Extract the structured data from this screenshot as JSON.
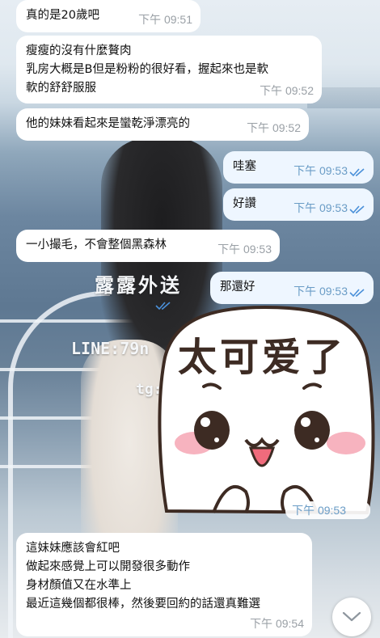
{
  "chat": {
    "messages": [
      {
        "id": "m1",
        "direction": "incoming",
        "text": "真的是20歲吧",
        "time": "下午 09:51"
      },
      {
        "id": "m2",
        "direction": "incoming",
        "text": "瘦瘦的沒有什麼贅肉\n乳房大概是B但是粉粉的很好看，握起來也是軟\n軟的舒舒服服",
        "time": "下午 09:52"
      },
      {
        "id": "m3",
        "direction": "incoming",
        "text": "他的妹妹看起來是蠻乾淨漂亮的",
        "time": "下午 09:52"
      },
      {
        "id": "m4",
        "direction": "outgoing",
        "text": "哇塞",
        "time": "下午 09:53",
        "read": true
      },
      {
        "id": "m5",
        "direction": "outgoing",
        "text": "好讚",
        "time": "下午 09:53",
        "read": true
      },
      {
        "id": "m6",
        "direction": "incoming",
        "text": "一小撮毛，不會整個黑森林",
        "time": "下午 09:53"
      },
      {
        "id": "m7",
        "direction": "outgoing",
        "text": "那還好",
        "time": "下午 09:53",
        "read": true
      },
      {
        "id": "m8",
        "direction": "outgoing",
        "type": "sticker",
        "sticker_text": "太可爱了",
        "time": "下午 09:53",
        "read": true
      },
      {
        "id": "m9",
        "direction": "incoming",
        "text": "這妹妹應該會紅吧\n做起來感覺上可以開發很多動作\n身材顏值又在水準上\n最近這幾個都很棒，然後要回約的話還真難選",
        "time": "下午 09:54"
      }
    ]
  },
  "background": {
    "watermark_line1": "露露外送",
    "watermark_line2": "LINE:79n",
    "watermark_line3": "tg:"
  },
  "icons": {
    "read_receipt": "double-check-icon",
    "scroll_button": "chevron-down-icon"
  },
  "colors": {
    "incoming_bubble": "#ffffff",
    "outgoing_bubble": "#eef6ff",
    "outgoing_time": "#6a9cc6",
    "check_color": "#4a90d9"
  }
}
